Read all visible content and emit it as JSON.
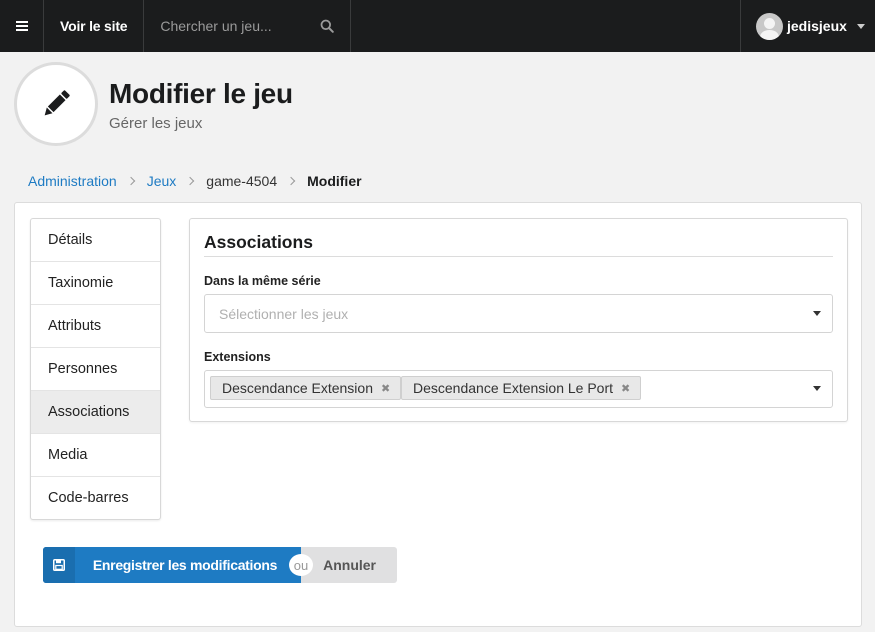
{
  "topbar": {
    "visit_site": "Voir le site",
    "search_placeholder": "Chercher un jeu...",
    "username": "jedisjeux"
  },
  "header": {
    "title": "Modifier le jeu",
    "subtitle": "Gérer les jeux"
  },
  "breadcrumb": {
    "admin": "Administration",
    "games": "Jeux",
    "game": "game-4504",
    "current": "Modifier"
  },
  "sidebar": {
    "items": [
      {
        "label": "Détails"
      },
      {
        "label": "Taxinomie"
      },
      {
        "label": "Attributs"
      },
      {
        "label": "Personnes"
      },
      {
        "label": "Associations"
      },
      {
        "label": "Media"
      },
      {
        "label": "Code-barres"
      }
    ],
    "active": "Associations"
  },
  "panel": {
    "title": "Associations",
    "series_label": "Dans la même série",
    "series_placeholder": "Sélectionner les jeux",
    "extensions_label": "Extensions",
    "extensions": [
      "Descendance Extension",
      "Descendance Extension Le Port"
    ]
  },
  "actions": {
    "save": "Enregistrer les modifications",
    "or": "ou",
    "cancel": "Annuler"
  },
  "colors": {
    "topbar": "#1b1c1d",
    "primary": "#1e7bc3",
    "link": "#1e7bc3"
  }
}
